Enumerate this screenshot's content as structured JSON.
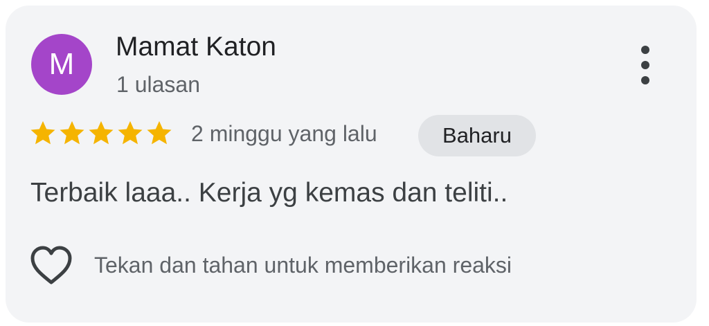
{
  "review": {
    "avatar_initial": "M",
    "reviewer_name": "Mamat Katon",
    "reviewer_review_count": "1 ulasan",
    "rating": 5,
    "rating_max": 5,
    "date": "2 minggu yang lalu",
    "badge": "Baharu",
    "text": "Terbaik laaa.. Kerja yg kemas dan teliti..",
    "reaction_hint": "Tekan dan tahan untuk memberikan reaksi"
  },
  "icons": {
    "more": "more-vert-icon",
    "star": "star-icon",
    "reaction": "heart-outline-icon"
  },
  "colors": {
    "avatar": "#a445c9",
    "star": "#f5b400",
    "card_background": "#f3f4f6",
    "badge_background": "#e1e3e6"
  }
}
